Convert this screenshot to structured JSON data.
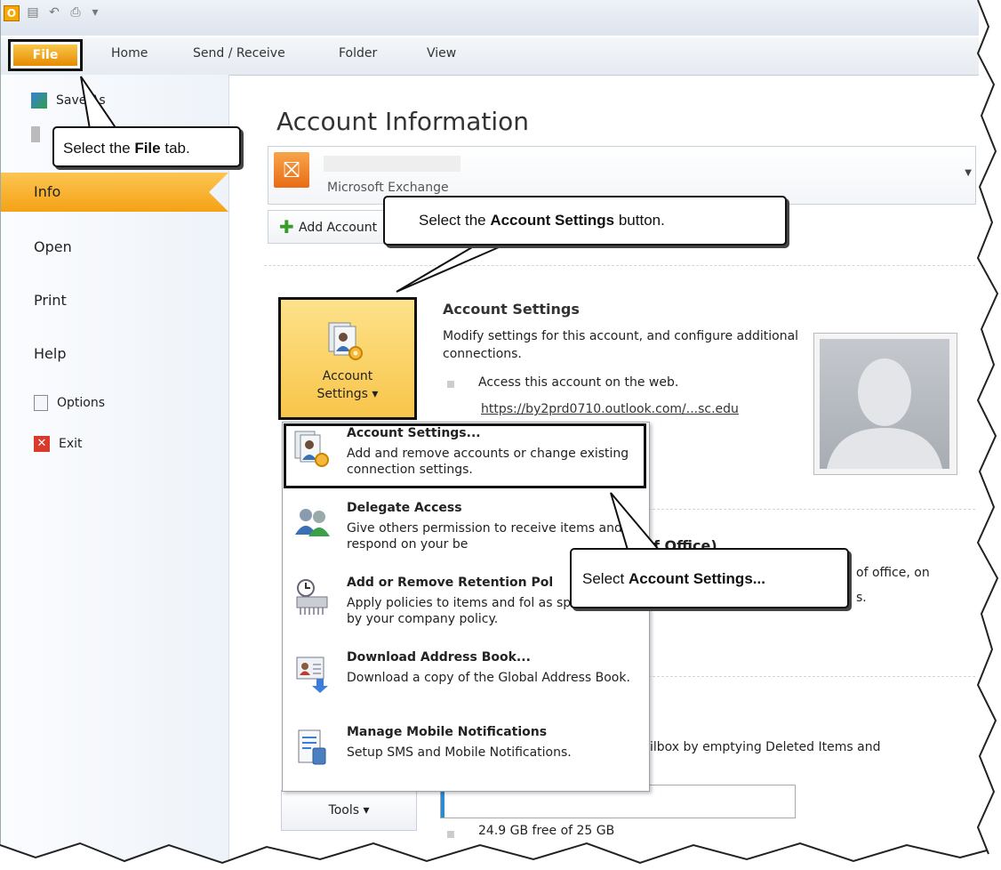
{
  "quick_access": {
    "outlook_logo": "O",
    "icons": [
      "save-icon",
      "undo-icon",
      "print-icon",
      "customize-icon"
    ]
  },
  "ribbon": {
    "tabs": [
      {
        "label": "File"
      },
      {
        "label": "Home"
      },
      {
        "label": "Send / Receive"
      },
      {
        "label": "Folder"
      },
      {
        "label": "View"
      }
    ]
  },
  "left_nav": {
    "save_as": "Save As",
    "items": [
      {
        "label": "Info",
        "active": true
      },
      {
        "label": "Open"
      },
      {
        "label": "Print"
      },
      {
        "label": "Help"
      }
    ],
    "options": "Options",
    "exit": "Exit"
  },
  "main": {
    "title": "Account Information",
    "account": {
      "type": "Microsoft Exchange"
    },
    "add_account": "Add Account",
    "account_settings_button": {
      "line1": "Account",
      "line2": "Settings ▾"
    },
    "section_title": "Account Settings",
    "section_desc": "Modify settings for this account, and configure additional connections.",
    "bullet_access": "Access this account on the web.",
    "web_link": "https://by2prd0710.outlook.com/...sc.edu",
    "fragment_oof_title": "f Office)",
    "fragment_oof_desc1": "of office, on",
    "fragment_oof_desc2": "s.",
    "fragment_cleanup": "ilbox by emptying Deleted Items and",
    "tools_button": "Tools ▾",
    "storage": {
      "text": "24.9 GB free of 25 GB",
      "used_fraction": 0.004
    }
  },
  "dropdown_menu": {
    "items": [
      {
        "title": "Account Settings...",
        "desc": "Add and remove accounts or change existing connection settings."
      },
      {
        "title": "Delegate Access",
        "desc": "Give others permission to receive items and respond on your be"
      },
      {
        "title": "Add or Remove Retention Pol",
        "desc": "Apply policies to items and fol as specified by your company policy."
      },
      {
        "title": "Download Address Book...",
        "desc": "Download a copy of the Global Address Book."
      },
      {
        "title": "Manage Mobile Notifications",
        "desc": "Setup SMS and Mobile Notifications."
      }
    ]
  },
  "callouts": {
    "file_tab": {
      "pre": "Select the ",
      "bold": "File",
      "post": " tab."
    },
    "account_settings_button": {
      "pre": "Select the ",
      "bold": "Account Settings",
      "post": " button."
    },
    "account_settings_menu": {
      "pre": "Select ",
      "bold": "Account Settings...",
      "post": ""
    }
  },
  "colors": {
    "accent_orange": "#f5a215",
    "highlight_yellow": "#f8c54a",
    "link": "#333333"
  }
}
